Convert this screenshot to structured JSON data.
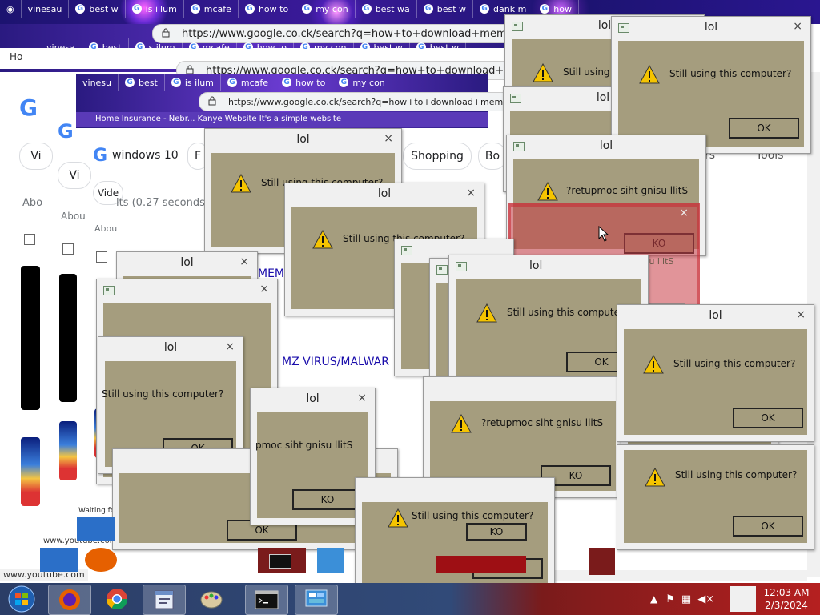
{
  "browser": {
    "tabs": [
      "vinesau",
      "best w",
      "is illum",
      "mcafe",
      "how to",
      "my con",
      "best wa",
      "best w",
      "dank m",
      "how"
    ],
    "tabs2": [
      "vinesa",
      "best",
      "s ilum",
      "mcafe",
      "how to",
      "my con",
      "best w",
      "best w"
    ],
    "tabs3": [
      "vinesu",
      "best",
      "is ilum",
      "mcafe",
      "how to",
      "my con",
      "best w",
      "best w"
    ],
    "url1": "https://www.google.co.ck/search?q=how+to+download+mem",
    "url2": "https://www.google.co.ck/search?q=how+to+download+mem",
    "url3": "https://www.google.co.ck/search?q=how+to+download+mem",
    "bookmarks": "Home Insurance - Nebr...   Kanye Website   It's a simple website",
    "home_label": "Ho",
    "home_label2": "Hol"
  },
  "search_page": {
    "query": "windows 10",
    "chips": [
      "Vi",
      "Vi",
      "Vide",
      "F",
      "Shopping",
      "Bo"
    ],
    "about_lines": [
      "Abo",
      "Abou",
      "Abou"
    ],
    "result_stats": "lts (0.27 seconds",
    "tools": "Tools",
    "rs": "rs",
    "result_title_1": "MEM",
    "result_title_2": "MZ VIRUS/MALWAR",
    "waiting": "Waiting fo",
    "footer_url": "www.youtube.com",
    "footer_url2": "www.youtube.com"
  },
  "dialog": {
    "title": "lol",
    "message": "Still using this computer?",
    "message_reversed": "?retupmoc siht gnisu llitS",
    "message_partial": "Still using th",
    "message_partial2": "Still using thi",
    "message_partial3": "pmoc siht gnisu llitS",
    "ok": "OK",
    "ok_reversed": "KO",
    "close": "×"
  },
  "taskbar": {
    "time": "12:03 AM",
    "date": "2/3/2024"
  },
  "colors": {
    "dialog_body": "#a59d7e",
    "taskbar_blue": "#2b3d66",
    "taskbar_red": "#b52020"
  }
}
